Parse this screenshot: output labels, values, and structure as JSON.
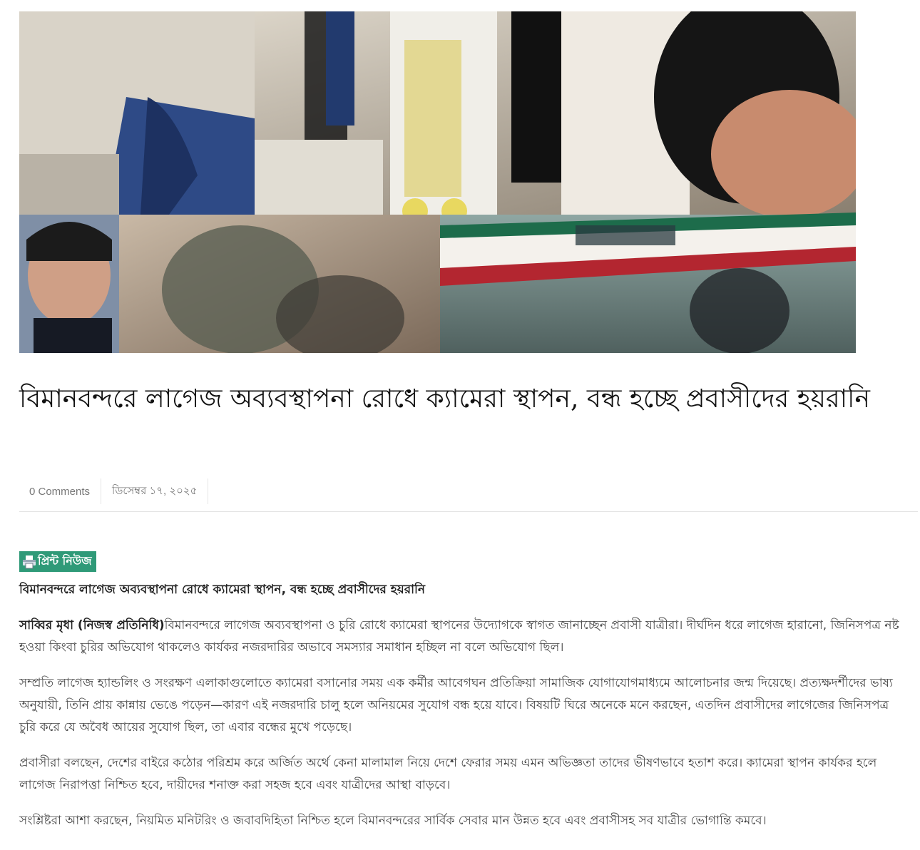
{
  "article": {
    "title": "বিমানবন্দরে লাগেজ অব্যবস্থাপনা রোধে ক্যামেরা স্থাপন, বন্ধ হচ্ছে প্রবাসীদের হয়রানি",
    "meta": {
      "comments": "0 Comments",
      "date": "ডিসেম্বর ১৭, ২০২৫"
    },
    "print_label": "প্রিন্ট নিউজ",
    "sub_title": "বিমানবন্দরে লাগেজ অব্যবস্থাপনা রোধে ক্যামেরা স্থাপন, বন্ধ হচ্ছে প্রবাসীদের হয়রানি",
    "byline": "সাব্বির মৃধা (নিজস্ব প্রতিনিধি)",
    "p1_text": "বিমানবন্দরে লাগেজ অব্যবস্থাপনা ও চুরি রোধে ক্যামেরা স্থাপনের উদ্যোগকে স্বাগত জানাচ্ছেন প্রবাসী যাত্রীরা। দীর্ঘদিন ধরে লাগেজ হারানো, জিনিসপত্র নষ্ট হওয়া কিংবা চুরির অভিযোগ থাকলেও কার্যকর নজরদারির অভাবে সমস্যার সমাধান হচ্ছিল না বলে অভিযোগ ছিল।",
    "p2": "সম্প্রতি লাগেজ হ্যান্ডলিং ও সংরক্ষণ এলাকাগুলোতে ক্যামেরা বসানোর সময় এক কর্মীর আবেগঘন প্রতিক্রিয়া সামাজিক যোগাযোগমাধ্যমে আলোচনার জন্ম দিয়েছে। প্রত্যক্ষদর্শীদের ভাষ্য অনুযায়ী, তিনি প্রায় কান্নায় ভেঙে পড়েন—কারণ এই নজরদারি চালু হলে অনিয়মের সুযোগ বন্ধ হয়ে যাবে। বিষয়টি ঘিরে অনেকে মনে করছেন, এতদিন প্রবাসীদের লাগেজের জিনিসপত্র চুরি করে যে অবৈধ আয়ের সুযোগ ছিল, তা এবার বন্ধের মুখে পড়েছে।",
    "p3": "প্রবাসীরা বলছেন, দেশের বাইরে কঠোর পরিশ্রম করে অর্জিত অর্থে কেনা মালামাল নিয়ে দেশে ফেরার সময় এমন অভিজ্ঞতা তাদের ভীষণভাবে হতাশ করে। ক্যামেরা স্থাপন কার্যকর হলে লাগেজ নিরাপত্তা নিশ্চিত হবে, দায়ীদের শনাক্ত করা সহজ হবে এবং যাত্রীদের আস্থা বাড়বে।",
    "p4": "সংশ্লিষ্টরা আশা করছেন, নিয়মিত মনিটরিং ও জবাবদিহিতা নিশ্চিত হলে বিমানবন্দরের সার্বিক সেবার মান উন্নত হবে এবং প্রবাসীসহ সব যাত্রীর ভোগান্তি কমবে।"
  },
  "colors": {
    "print_button_bg": "#2f9a78",
    "divider": "#e3e3e3"
  },
  "icons": {
    "print": "printer-icon"
  }
}
